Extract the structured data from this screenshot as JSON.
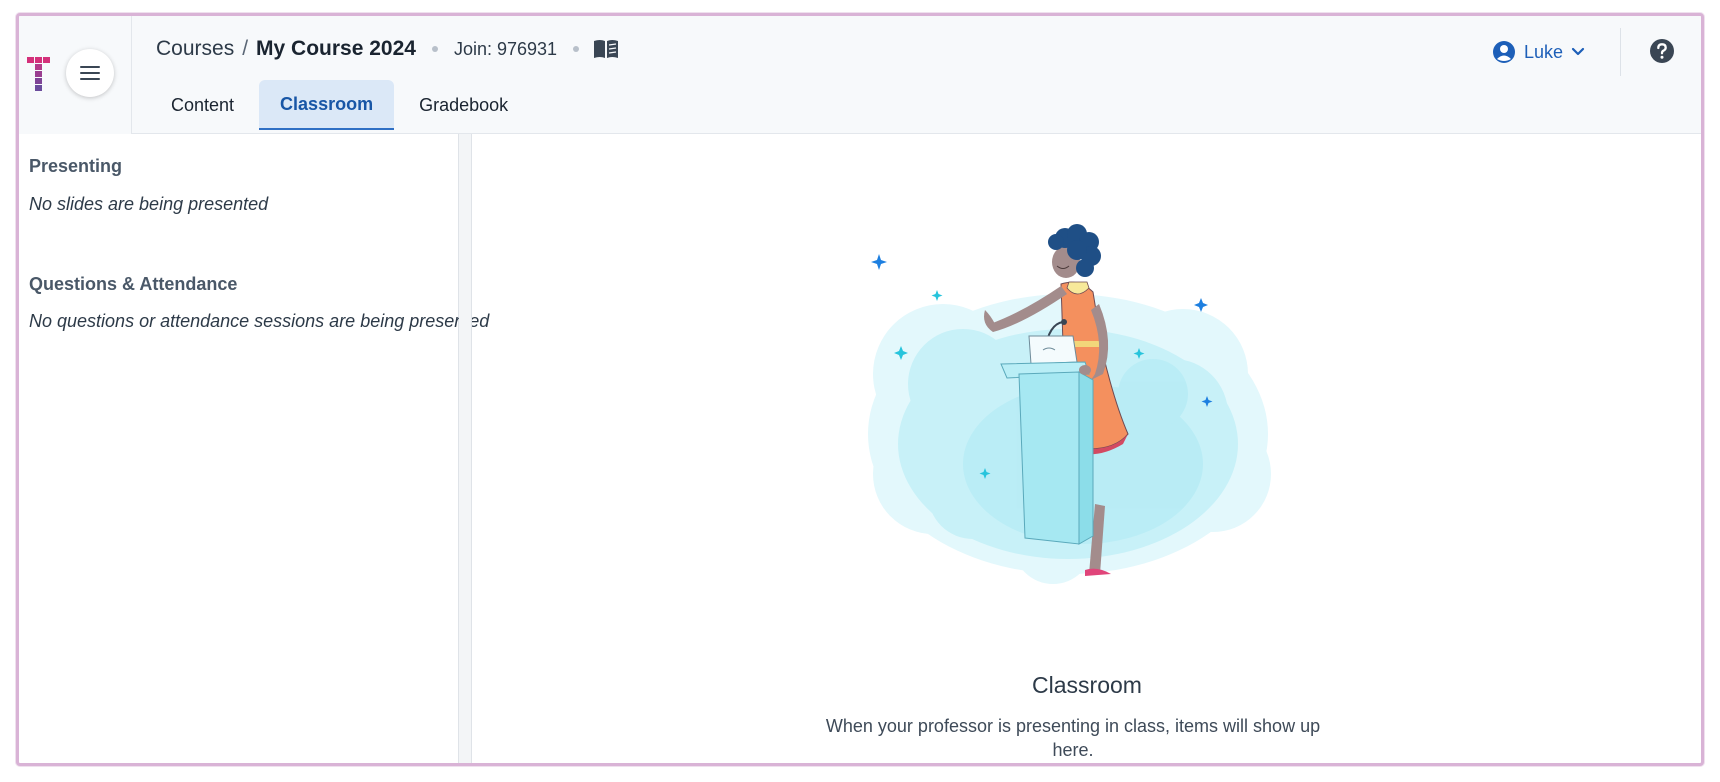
{
  "breadcrumb": {
    "courses": "Courses",
    "separator": "/",
    "current": "My Course 2024"
  },
  "join": {
    "text": "Join: 976931"
  },
  "tabs": [
    {
      "label": "Content",
      "active": false
    },
    {
      "label": "Classroom",
      "active": true
    },
    {
      "label": "Gradebook",
      "active": false
    }
  ],
  "user": {
    "name": "Luke",
    "icon": "user-circle-icon"
  },
  "icons": {
    "menu": "hamburger-menu-icon",
    "book": "book-open-icon",
    "chevron": "chevron-down-icon",
    "help": "help-circle-icon"
  },
  "sidebar": {
    "presenting": {
      "heading": "Presenting",
      "empty": "No slides are being presented"
    },
    "questions": {
      "heading": "Questions & Attendance",
      "empty": "No questions or attendance sessions are being presented"
    }
  },
  "main": {
    "title": "Classroom",
    "description": "When your professor is presenting in class, items will show up here."
  },
  "colors": {
    "accent": "#1d5fb8",
    "active_tab_bg": "#dbe8f7",
    "frame_border": "#d9b3d6"
  }
}
